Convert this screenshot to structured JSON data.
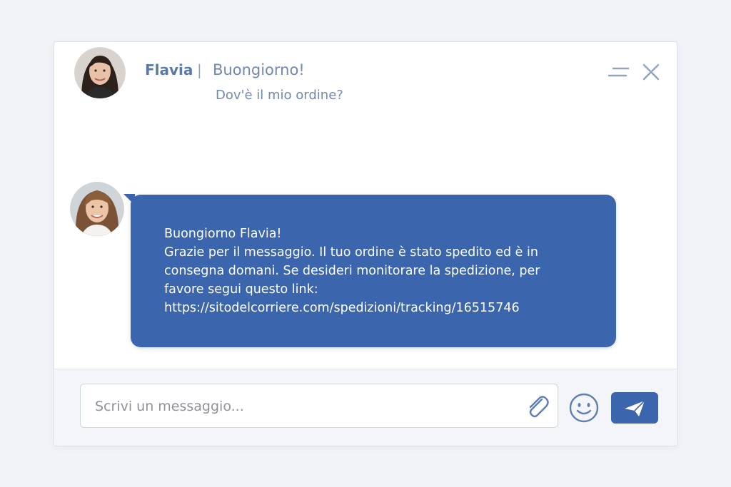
{
  "header": {
    "name": "Flavia",
    "separator": "|",
    "greeting": "Buongiorno!",
    "question": "Dov'è il mio ordine?",
    "minimize_icon": "minimize-icon",
    "close_icon": "close-icon"
  },
  "message": {
    "lines": [
      "Buongiorno Flavia!",
      "Grazie per il messaggio. Il tuo ordine è stato spedito ed è in",
      "consegna domani. Se desideri monitorare la spedizione, per",
      "favore segui questo link:",
      "https://sitodelcorriere.com/spedizioni/tracking/16515746"
    ]
  },
  "composer": {
    "placeholder": "Scrivi un messaggio...",
    "attach_icon": "paperclip-icon",
    "emoji_icon": "smiley-icon",
    "send_icon": "paper-plane-icon"
  },
  "colors": {
    "accent": "#3b65ad",
    "header_text": "#5b78a6",
    "background": "#f1f3f7"
  }
}
